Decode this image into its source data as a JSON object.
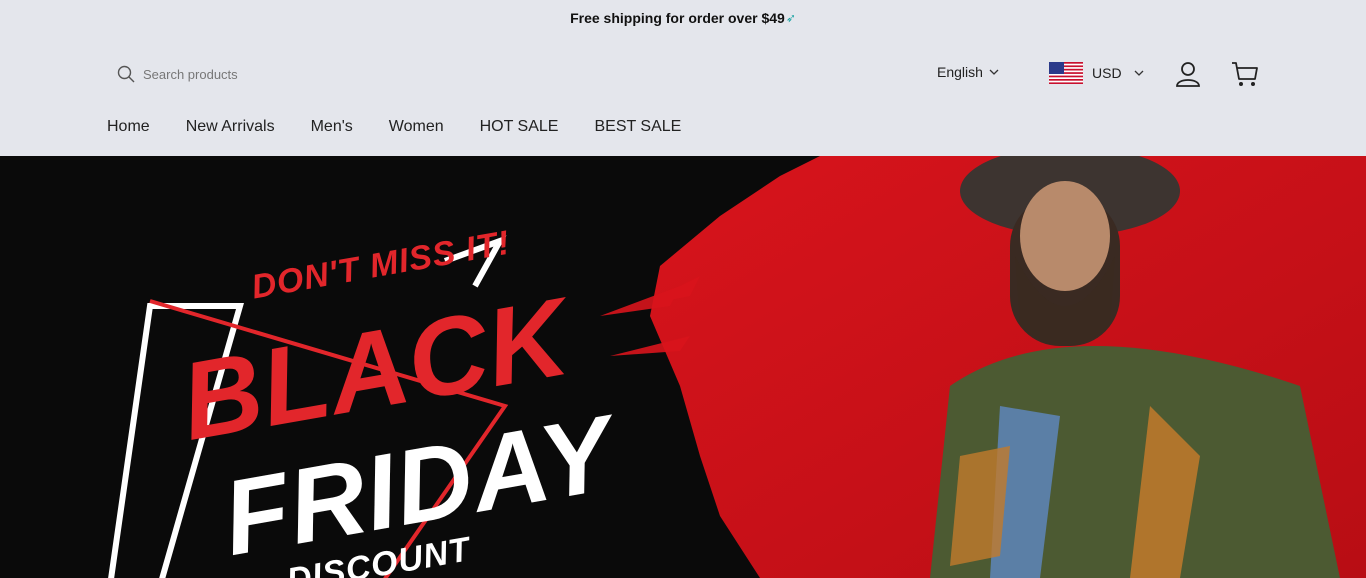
{
  "announcement": {
    "text": "Free shipping for order over $49",
    "icon": "rocket-icon"
  },
  "search": {
    "placeholder": "Search products",
    "icon": "search-icon"
  },
  "language": {
    "selected": "English"
  },
  "currency": {
    "selected": "USD",
    "flag": "us-flag-icon"
  },
  "icons": {
    "user": "user-icon",
    "cart": "cart-icon"
  },
  "nav": {
    "items": [
      {
        "label": "Home"
      },
      {
        "label": "New Arrivals"
      },
      {
        "label": "Men's"
      },
      {
        "label": "Women"
      },
      {
        "label": "HOT SALE"
      },
      {
        "label": "BEST SALE"
      }
    ]
  },
  "hero": {
    "tagline": "DON'T MISS IT!",
    "line1": "BLACK",
    "line2": "FRIDAY",
    "line3": "DISCOUNT"
  },
  "colors": {
    "accent_red": "#e2262b",
    "hero_bg": "#0a0a0a",
    "header_bg": "#e4e6ec"
  }
}
